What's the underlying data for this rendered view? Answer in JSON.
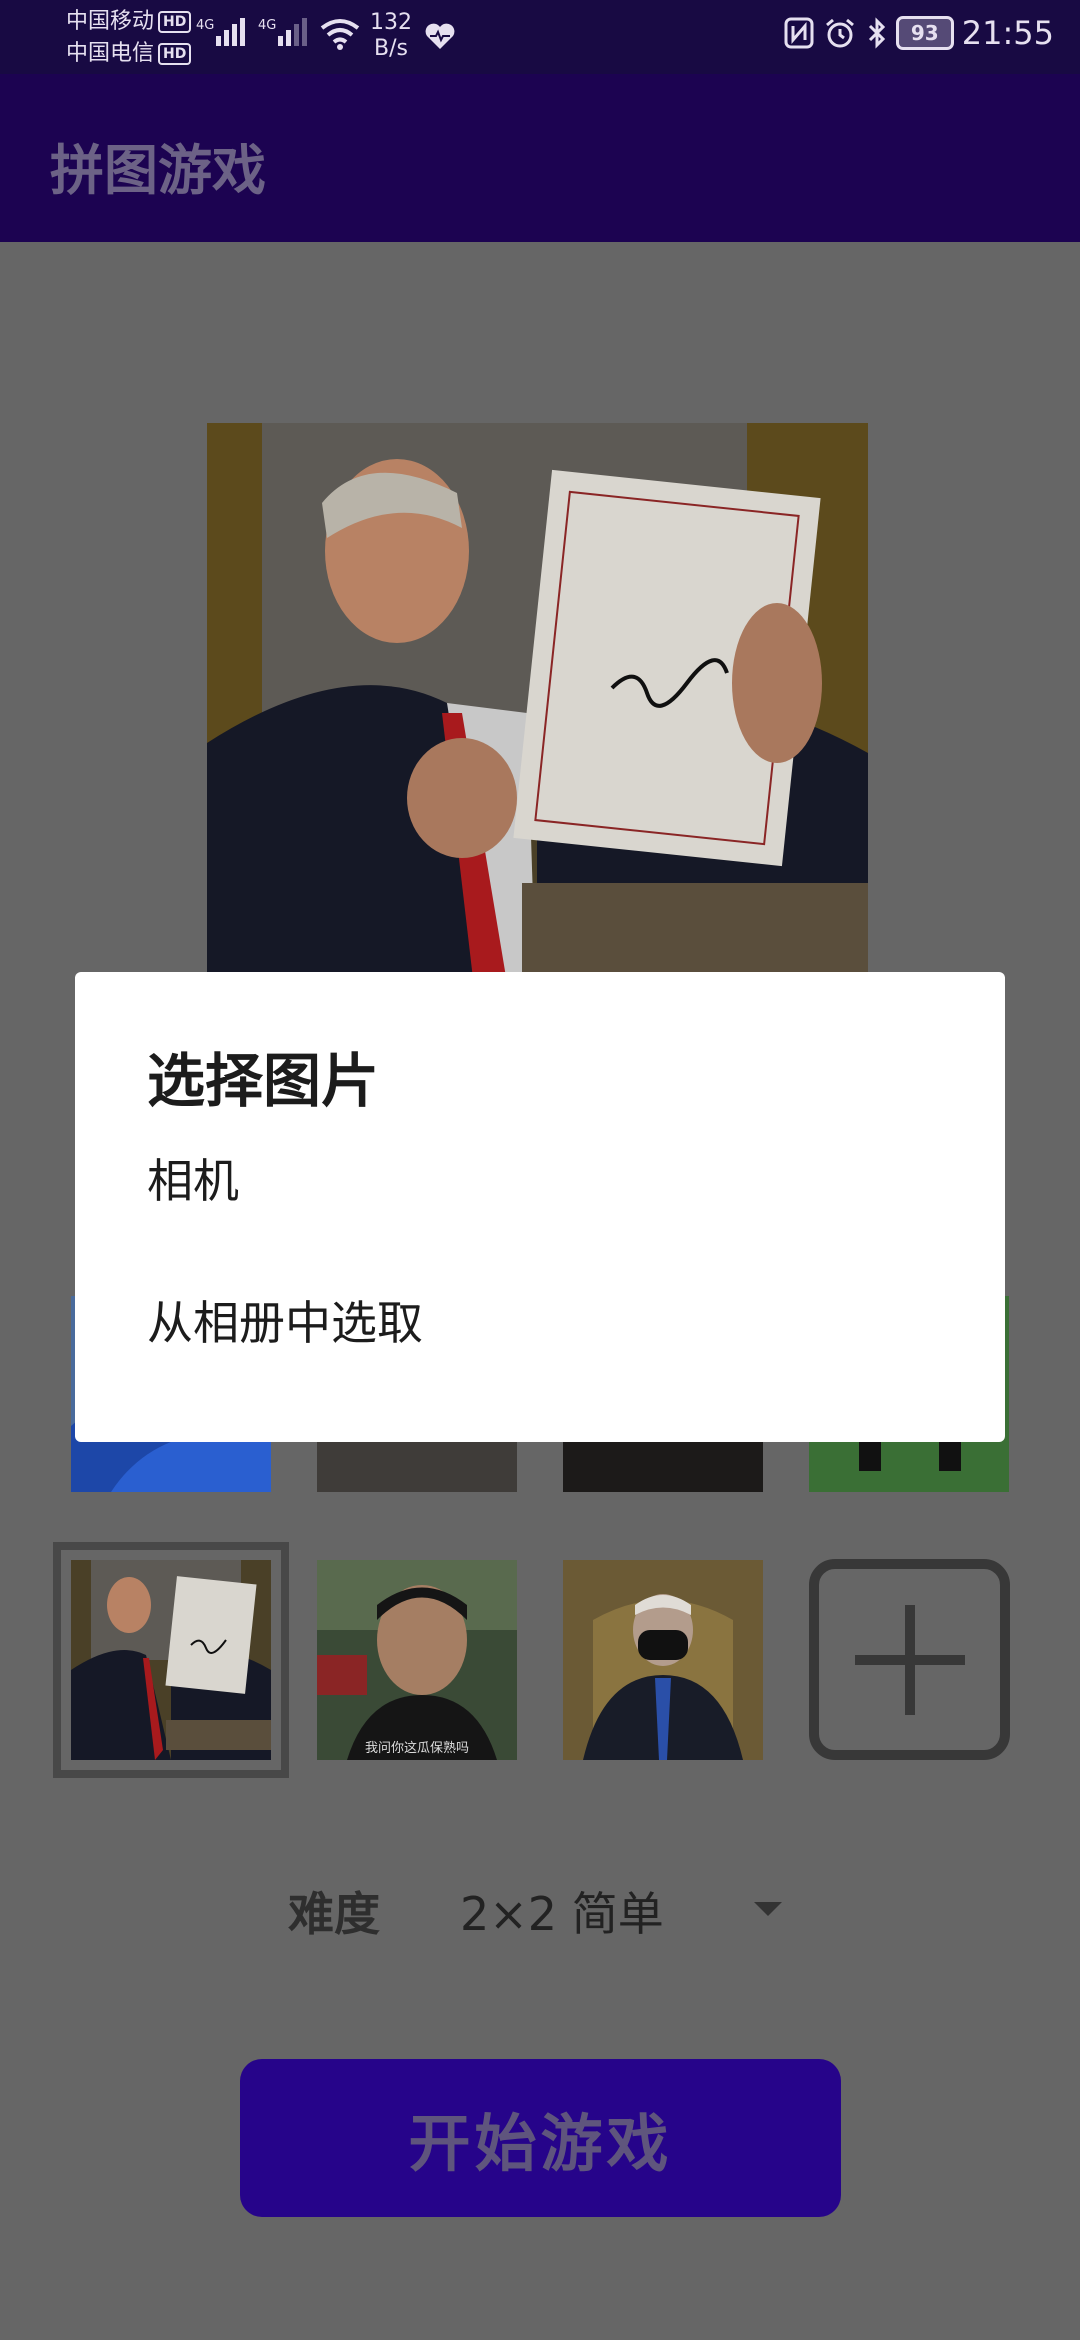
{
  "status_bar": {
    "carrier1": "中国移动",
    "carrier2": "中国电信",
    "hd": "HD",
    "net1": "4G",
    "net2": "4G",
    "speed_value": "132",
    "speed_unit": "B/s",
    "battery": "93",
    "time": "21:55"
  },
  "app_bar": {
    "title": "拼图游戏"
  },
  "thumbnails_row2": {
    "caption_chinese_face": "我问你这瓜保熟吗"
  },
  "difficulty": {
    "label": "难度",
    "value": "2×2  简单"
  },
  "start_button": {
    "label": "开始游戏"
  },
  "dialog": {
    "title": "选择图片",
    "items": [
      {
        "label": "相机"
      },
      {
        "label": "从相册中选取"
      }
    ]
  },
  "colors": {
    "overlay": "#666666",
    "app_bar": "#1c0351",
    "accent": "#26048a"
  }
}
